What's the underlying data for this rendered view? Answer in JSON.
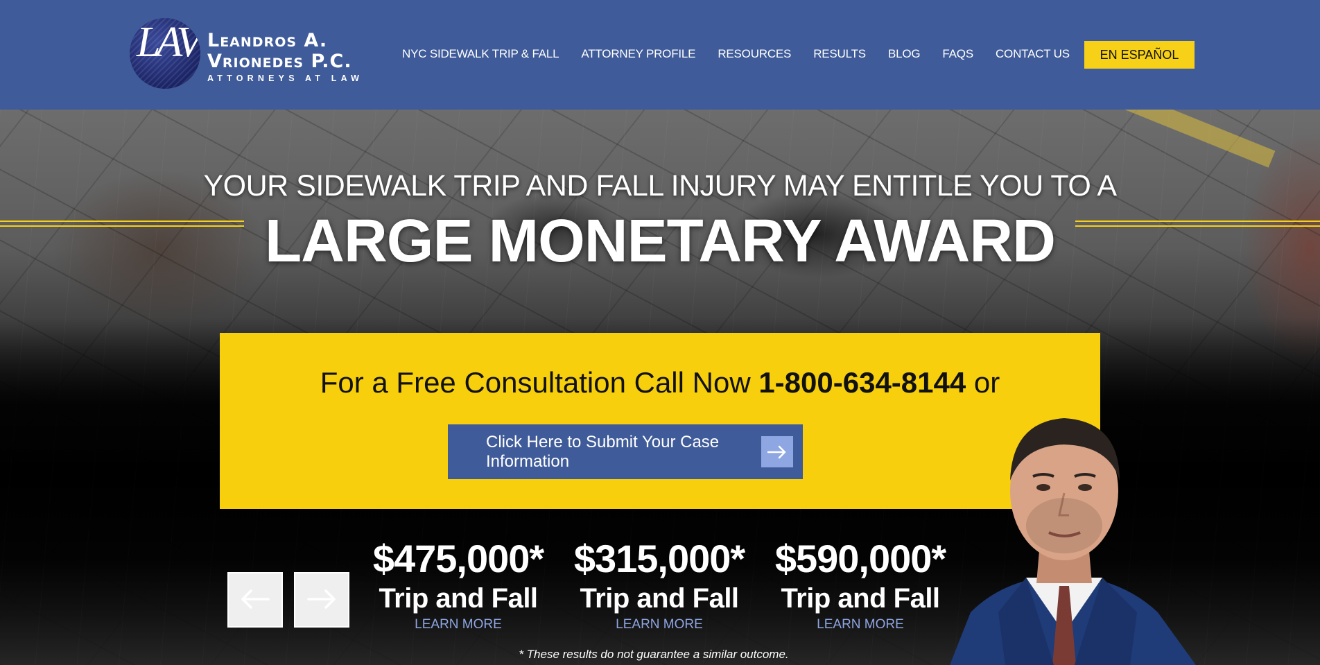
{
  "header": {
    "logo": {
      "monogram": "LAV",
      "line1": "Leandros A.",
      "line2": "Vrionedes P.C.",
      "line3": "ATTORNEYS AT LAW"
    },
    "nav": [
      {
        "label": "NYC SIDEWALK TRIP & FALL"
      },
      {
        "label": "ATTORNEY PROFILE"
      },
      {
        "label": "RESOURCES"
      },
      {
        "label": "RESULTS"
      },
      {
        "label": "BLOG"
      },
      {
        "label": "FAQS"
      },
      {
        "label": "CONTACT US"
      }
    ],
    "language_button": "EN ESPAÑOL"
  },
  "hero": {
    "subtitle": "YOUR SIDEWALK TRIP AND FALL INJURY MAY ENTITLE YOU TO A",
    "title": "LARGE MONETARY AWARD",
    "cta": {
      "prefix": "For a Free Consultation Call Now",
      "phone": "1-800-634-8144",
      "suffix": "or",
      "button_label": "Click Here to Submit Your Case Information"
    }
  },
  "results": [
    {
      "amount": "$475,000*",
      "type": "Trip and Fall",
      "link": "LEARN MORE"
    },
    {
      "amount": "$315,000*",
      "type": "Trip and Fall",
      "link": "LEARN MORE"
    },
    {
      "amount": "$590,000*",
      "type": "Trip and Fall",
      "link": "LEARN MORE"
    }
  ],
  "disclaimer": "* These results do not guarantee a similar outcome.",
  "colors": {
    "header_bg": "#3f5b99",
    "accent_yellow": "#f7cf0c",
    "link_blue": "#8ea6e2"
  },
  "icons": [
    "arrow-left-icon",
    "arrow-right-icon",
    "arrow-right-icon"
  ]
}
